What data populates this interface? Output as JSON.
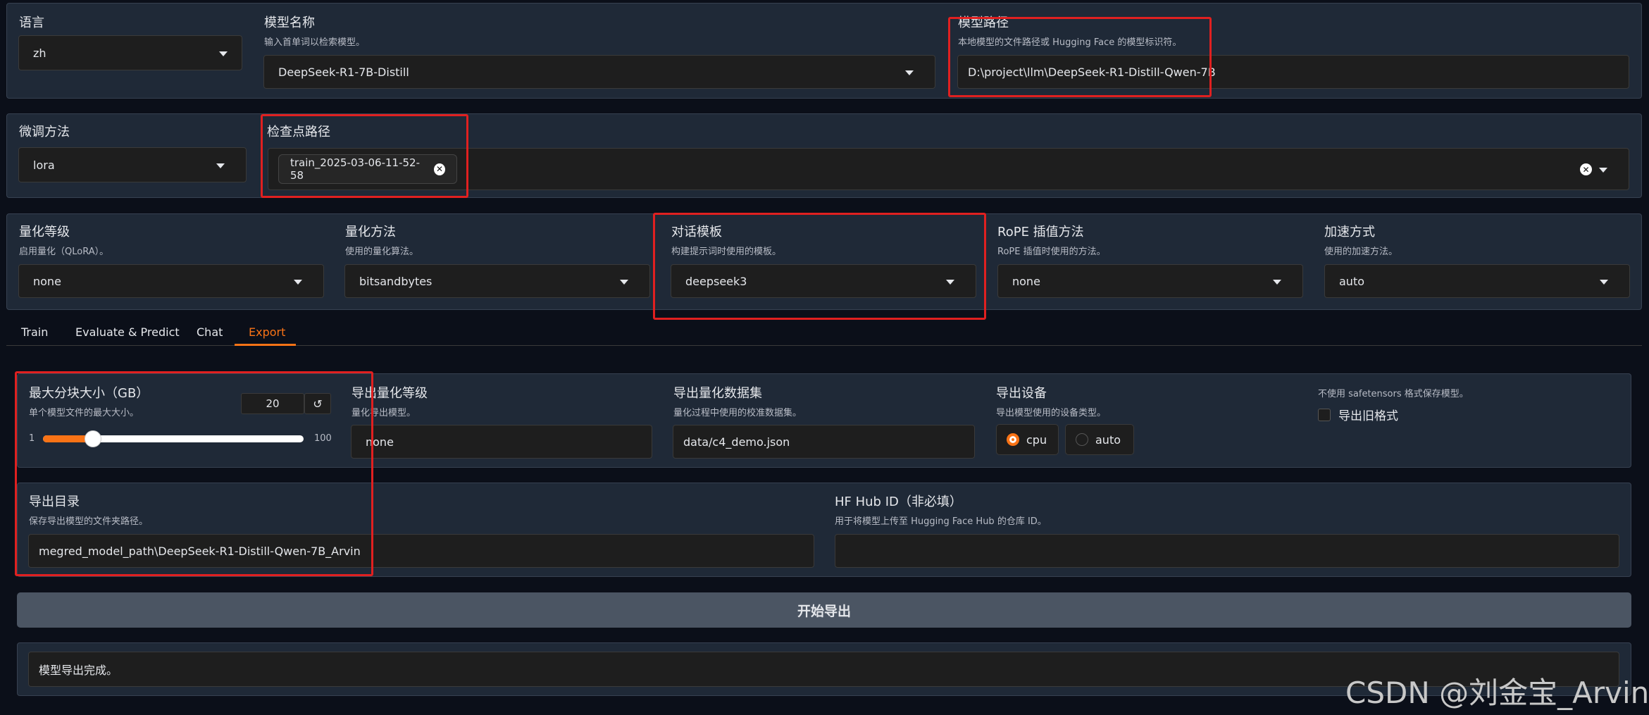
{
  "model_row": {
    "language": {
      "label": "语言",
      "value": "zh"
    },
    "model_name": {
      "label": "模型名称",
      "info": "输入首单词以检索模型。",
      "value": "DeepSeek-R1-7B-Distill"
    },
    "model_path": {
      "label": "模型路径",
      "info": "本地模型的文件路径或 Hugging Face 的模型标识符。",
      "value": "D:\\project\\llm\\DeepSeek-R1-Distill-Qwen-7B"
    }
  },
  "finetune_row": {
    "method": {
      "label": "微调方法",
      "value": "lora"
    },
    "checkpoint": {
      "label": "检查点路径",
      "chip": "train_2025-03-06-11-52-58",
      "clear_icon": "close-circle-icon"
    }
  },
  "advanced_row": {
    "quant_bit": {
      "label": "量化等级",
      "info": "启用量化（QLoRA）。",
      "value": "none"
    },
    "quant_method": {
      "label": "量化方法",
      "info": "使用的量化算法。",
      "value": "bitsandbytes"
    },
    "template": {
      "label": "对话模板",
      "info": "构建提示词时使用的模板。",
      "value": "deepseek3"
    },
    "rope": {
      "label": "RoPE 插值方法",
      "info": "RoPE 插值时使用的方法。",
      "value": "none"
    },
    "booster": {
      "label": "加速方式",
      "info": "使用的加速方法。",
      "value": "auto"
    }
  },
  "tabs": [
    {
      "label": "Train"
    },
    {
      "label": "Evaluate & Predict"
    },
    {
      "label": "Chat"
    },
    {
      "label": "Export"
    }
  ],
  "export": {
    "max_shard": {
      "label": "最大分块大小（GB）",
      "info": "单个模型文件的最大大小。",
      "value": "20",
      "min": "1",
      "max": "100",
      "fraction": 0.192,
      "reset_icon": "reset-icon"
    },
    "quant_bit": {
      "label": "导出量化等级",
      "info": "量化导出模型。",
      "value": "none"
    },
    "quant_dataset": {
      "label": "导出量化数据集",
      "info": "量化过程中使用的校准数据集。",
      "value": "data/c4_demo.json"
    },
    "device": {
      "label": "导出设备",
      "info": "导出模型使用的设备类型。",
      "options": [
        "cpu",
        "auto"
      ],
      "selected": "cpu"
    },
    "legacy": {
      "info": "不使用 safetensors 格式保存模型。",
      "label": "导出旧格式"
    },
    "dir": {
      "label": "导出目录",
      "info": "保存导出模型的文件夹路径。",
      "value": "megred_model_path\\DeepSeek-R1-Distill-Qwen-7B_Arvin"
    },
    "hub": {
      "label": "HF Hub ID（非必填）",
      "info": "用于将模型上传至 Hugging Face Hub 的仓库 ID。",
      "value": ""
    },
    "button": "开始导出",
    "output": "模型导出完成。"
  },
  "watermark": "CSDN @刘金宝_Arvin",
  "colors": {
    "accent": "#f97316",
    "highlight": "#e02020",
    "panel": "#1f2937"
  }
}
